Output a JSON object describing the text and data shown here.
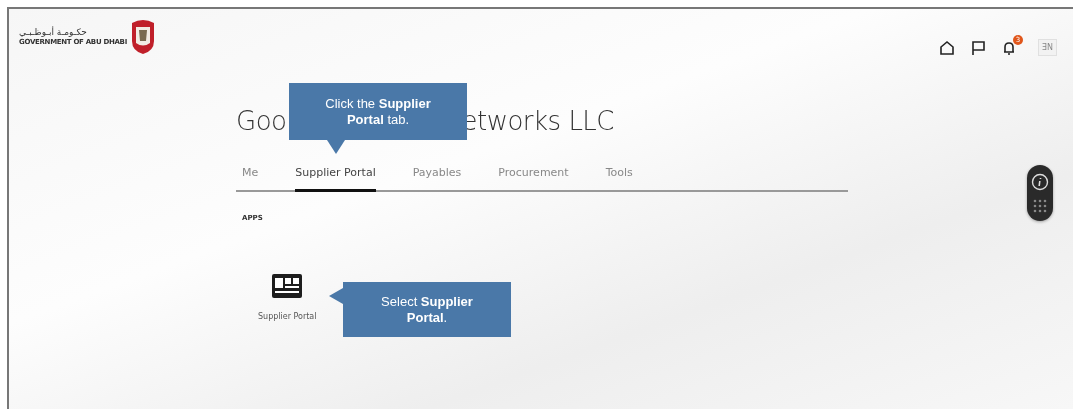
{
  "header": {
    "logo_arabic": "حكـومـة أبـوظـبـي",
    "logo_english": "GOVERNMENT OF ABU DHABI",
    "notification_count": "3",
    "language": "ƎN"
  },
  "heading_parts": [
    "Goo",
    "etworks LLC"
  ],
  "tabs": [
    {
      "label": "Me",
      "selected": false
    },
    {
      "label": "Supplier Portal",
      "selected": true
    },
    {
      "label": "Payables",
      "selected": false
    },
    {
      "label": "Procurement",
      "selected": false
    },
    {
      "label": "Tools",
      "selected": false
    }
  ],
  "section_label": "APPS",
  "apps": [
    {
      "label": "Supplier Portal"
    }
  ],
  "callouts": [
    {
      "kind": "down",
      "text": "Click the **Supplier Portal** tab."
    },
    {
      "kind": "left",
      "text": "Select **Supplier Portal**."
    }
  ]
}
